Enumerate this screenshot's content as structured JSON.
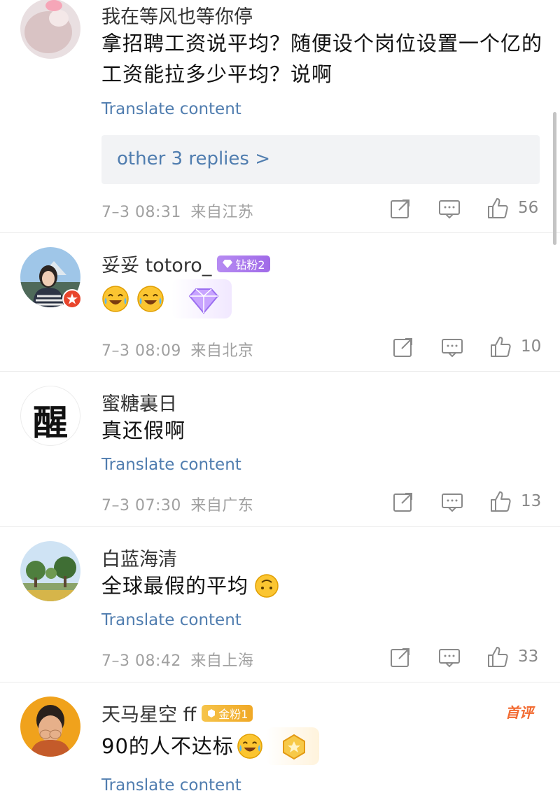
{
  "translate_label": "Translate content",
  "comments": [
    {
      "username": "我在等风也等你停",
      "text": "拿招聘工资说平均？随便设个岗位设置一个亿的工资能拉多少平均？说啊",
      "replies_label": "other 3 replies >",
      "time": "7–3 08:31",
      "location": "来自江苏",
      "likes": "56"
    },
    {
      "username": "妥妥 totoro_",
      "badge": "钻粉2",
      "time": "7–3 08:09",
      "location": "来自北京",
      "likes": "10"
    },
    {
      "username": "蜜糖裏日",
      "avatar_text": "醒",
      "text": "真还假啊",
      "time": "7–3 07:30",
      "location": "来自广东",
      "likes": "13"
    },
    {
      "username": "白蓝海清",
      "text": "全球最假的平均",
      "time": "7–3 08:42",
      "location": "来自上海",
      "likes": "33"
    },
    {
      "username": "天马星空 ff",
      "badge": "金粉1",
      "top_label": "首评",
      "text": "90的人不达标"
    }
  ],
  "icons": [
    "share-icon",
    "comment-icon",
    "thumbs-up-icon",
    "laughing-crying-emoji",
    "upside-down-face-emoji",
    "diamond-fan-icon",
    "gold-fan-icon"
  ],
  "colors": {
    "link": "#507daf",
    "meta": "#a0a0a0",
    "badge_purple": "#a06ae8",
    "badge_gold": "#f0a826",
    "first_label": "#f26a30"
  }
}
